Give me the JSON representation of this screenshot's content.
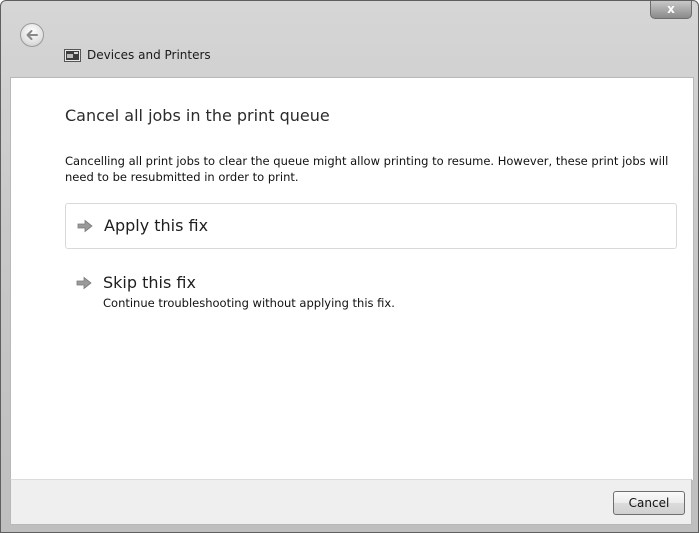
{
  "window": {
    "title": "Devices and Printers",
    "close_label": "x"
  },
  "page": {
    "heading": "Cancel all jobs in the print queue",
    "description": "Cancelling all print jobs to clear the queue might allow printing to resume. However, these print jobs will need to be resubmitted in order to print."
  },
  "options": {
    "apply": {
      "title": "Apply this fix"
    },
    "skip": {
      "title": "Skip this fix",
      "subtitle": "Continue troubleshooting without applying this fix."
    }
  },
  "footer": {
    "cancel_label": "Cancel"
  },
  "icons": {
    "back": "back-arrow-icon",
    "title": "devices-printers-icon",
    "option_arrow": "green-arrow-icon"
  },
  "colors": {
    "option_arrow": "#7aa84a"
  }
}
